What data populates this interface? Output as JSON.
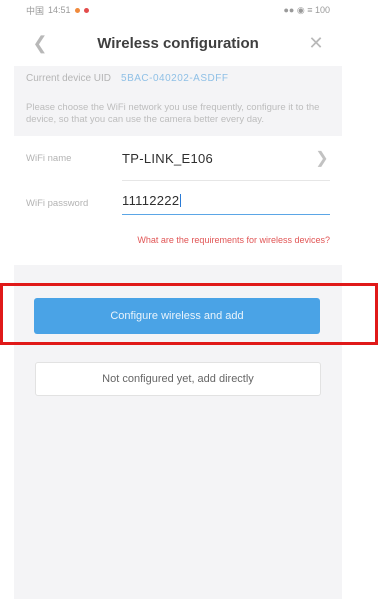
{
  "statusbar": {
    "time": "14:51",
    "carrier": "中国",
    "right_text": "●● ◉ ≡ 100"
  },
  "header": {
    "title": "Wireless configuration",
    "back_icon": "chevron-left-icon",
    "close_icon": "close-icon"
  },
  "device": {
    "label": "Current device UID",
    "uid": "5BAC-040202-ASDFF"
  },
  "hint": "Please choose the WiFi network you use frequently, configure it to the device, so that you can use the camera better every day.",
  "form": {
    "wifi_name_label": "WiFi name",
    "wifi_name_value": "TP-LINK_E106",
    "wifi_password_label": "WiFi password",
    "wifi_password_value": "11112222"
  },
  "requirements_link": "What are the requirements for wireless devices?",
  "buttons": {
    "configure": "Configure wireless and add",
    "add_directly": "Not configured yet, add directly"
  },
  "colors": {
    "accent": "#4aa3e6",
    "link_red": "#e15555",
    "highlight": "#e01919"
  }
}
